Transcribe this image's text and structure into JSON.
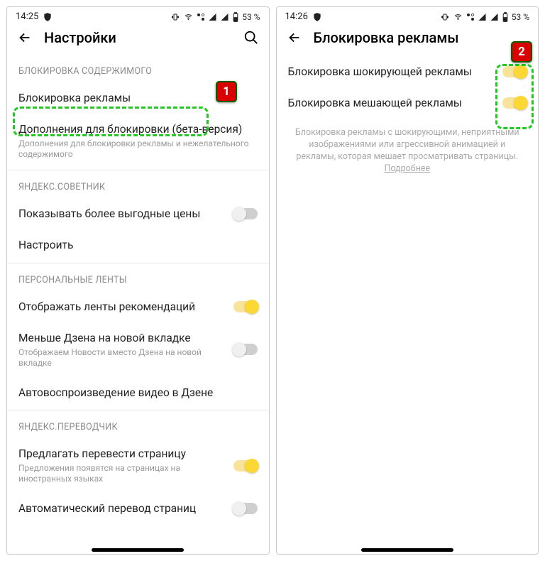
{
  "left": {
    "status": {
      "time": "14:25",
      "battery": "53 %"
    },
    "appbar": {
      "title": "Настройки"
    },
    "sections": {
      "content_block": {
        "header": "БЛОКИРОВКА СОДЕРЖИМОГО",
        "ad_block": "Блокировка рекламы",
        "addons_title": "Дополнения для блокировки (бета-версия)",
        "addons_sub": "Дополнения для блокировки рекламы и нежелательного содержимого"
      },
      "sovetnik": {
        "header": "ЯНДЕКС.СОВЕТНИК",
        "better_prices": "Показывать более выгодные цены",
        "configure": "Настроить"
      },
      "feeds": {
        "header": "ПЕРСОНАЛЬНЫЕ ЛЕНТЫ",
        "show_feeds": "Отображать ленты рекомендаций",
        "less_zen": "Меньше Дзена на новой вкладке",
        "less_zen_sub": "Отображаем Новости вместо Дзена на новой вкладке",
        "autoplay": "Автовоспроизведение видео в Дзене"
      },
      "translator": {
        "header": "ЯНДЕКС.ПЕРЕВОДЧИК",
        "offer_title": "Предлагать перевести страницу",
        "offer_sub": "Предложения появятся на страницах на иностранных языках",
        "auto": "Автоматический перевод страниц"
      }
    },
    "callout": "1"
  },
  "right": {
    "status": {
      "time": "14:26",
      "battery": "53 %"
    },
    "appbar": {
      "title": "Блокировка рекламы"
    },
    "rows": {
      "shocking": "Блокировка шокирующей рекламы",
      "annoying": "Блокировка мешающей рекламы"
    },
    "info": "Блокировка рекламы с шокирующими, неприятными изображениями или агрессивной анимацией и рекламы, которая мешает просматривать страницы.",
    "info_link": "Подробнее",
    "callout": "2"
  }
}
